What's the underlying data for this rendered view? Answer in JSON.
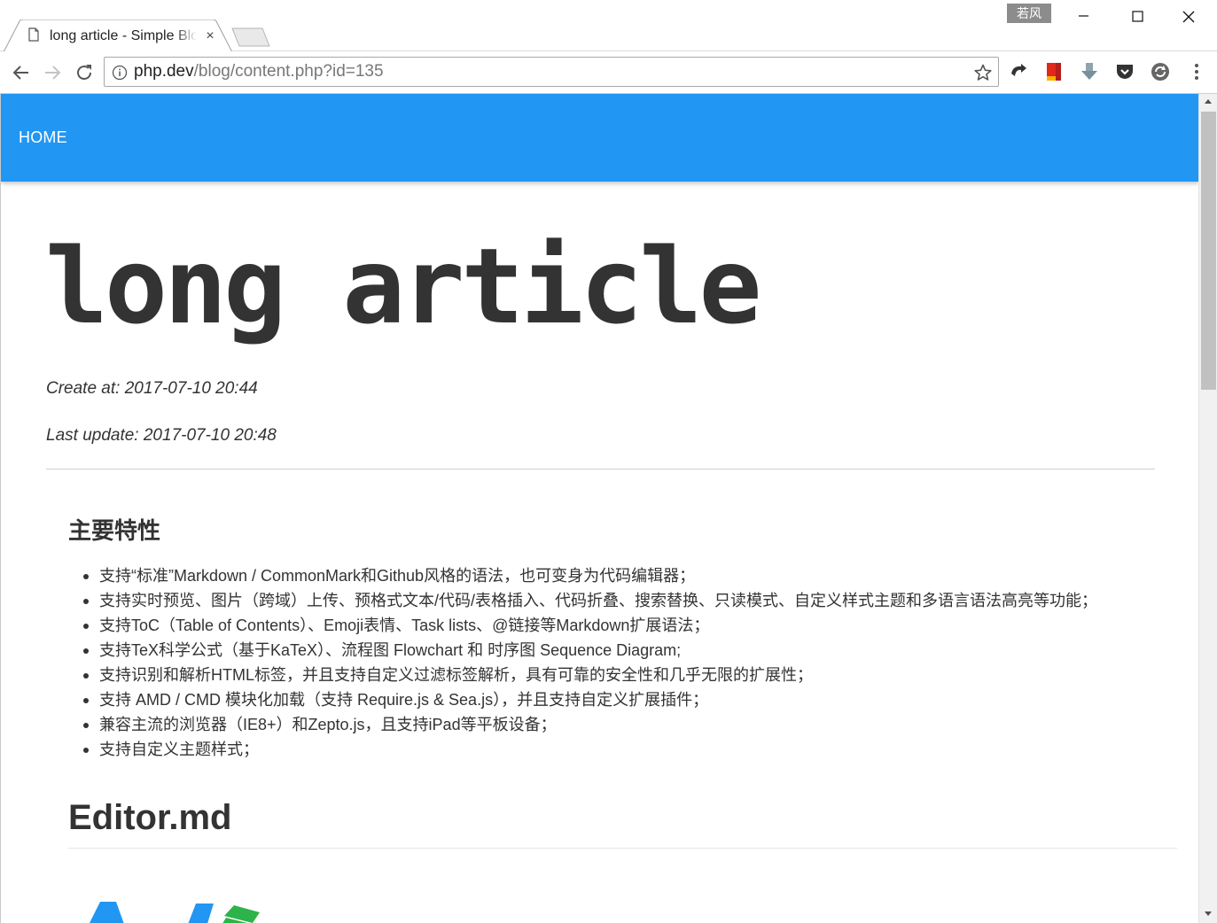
{
  "browser": {
    "tab_title": "long article - Simple Blog",
    "tab_close": "×",
    "profile_name": "若风",
    "url_host": "php.dev",
    "url_path": "/blog/content.php?id=135"
  },
  "navbar": {
    "home_label": "HOME",
    "color": "#2196f3"
  },
  "article": {
    "title": "long article",
    "created": "Create at: 2017-07-10 20:44",
    "updated": "Last update: 2017-07-10 20:48",
    "section_heading": "主要特性",
    "features": [
      "支持“标准”Markdown / CommonMark和Github风格的语法，也可变身为代码编辑器；",
      "支持实时预览、图片（跨域）上传、预格式文本/代码/表格插入、代码折叠、搜索替换、只读模式、自定义样式主题和多语言语法高亮等功能；",
      "支持ToC（Table of Contents）、Emoji表情、Task lists、@链接等Markdown扩展语法；",
      "支持TeX科学公式（基于KaTeX）、流程图 Flowchart 和 时序图 Sequence Diagram;",
      "支持识别和解析HTML标签，并且支持自定义过滤标签解析，具有可靠的安全性和几乎无限的扩展性；",
      "支持 AMD / CMD 模块化加载（支持 Require.js & Sea.js），并且支持自定义扩展插件；",
      "兼容主流的浏览器（IE8+）和Zepto.js，且支持iPad等平板设备；",
      "支持自定义主题样式；"
    ],
    "editor_heading": "Editor.md"
  },
  "icons": {
    "page": "page-icon",
    "info": "info-icon",
    "back": "back-arrow-icon",
    "forward": "forward-arrow-icon",
    "reload": "reload-icon",
    "star": "star-icon",
    "menu": "menu-dots-icon"
  }
}
